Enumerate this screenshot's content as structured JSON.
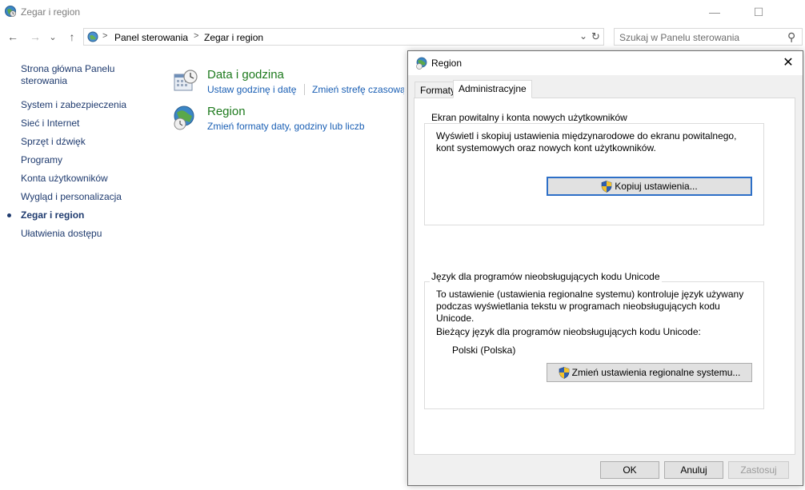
{
  "window": {
    "title": "Zegar i region",
    "controls": {
      "minimize": "—",
      "maximize": "☐"
    }
  },
  "nav": {
    "back": "←",
    "forward": "→",
    "recent": "⌄",
    "up": "↑"
  },
  "address": {
    "crumbs": [
      "Panel sterowania",
      "Zegar i region"
    ],
    "separator": ">",
    "dropdown": "⌄",
    "refresh": "↻"
  },
  "search": {
    "placeholder": "Szukaj w Panelu sterowania",
    "icon": "⚲"
  },
  "sidebar": {
    "items": [
      {
        "label": "Strona główna Panelu",
        "label2": "sterowania"
      },
      {
        "label": "System i zabezpieczenia"
      },
      {
        "label": "Sieć i Internet"
      },
      {
        "label": "Sprzęt i dźwięk"
      },
      {
        "label": "Programy"
      },
      {
        "label": "Konta użytkowników"
      },
      {
        "label": "Wygląd i personalizacja"
      },
      {
        "label": "Zegar i region",
        "active": true
      },
      {
        "label": "Ułatwienia dostępu"
      }
    ]
  },
  "categories": [
    {
      "title": "Data i godzina",
      "links": [
        "Ustaw godzinę i datę",
        "Zmień strefę czasową"
      ]
    },
    {
      "title": "Region",
      "links": [
        "Zmień formaty daty, godziny lub liczb"
      ]
    }
  ],
  "dialog": {
    "title": "Region",
    "close": "✕",
    "tabs": [
      {
        "label": "Formaty",
        "selected": false
      },
      {
        "label": "Administracyjne",
        "selected": true
      }
    ],
    "group1": {
      "legend": "Ekran powitalny i konta nowych użytkowników",
      "line1": "Wyświetl i skopiuj ustawienia międzynarodowe do ekranu powitalnego,",
      "line2": "kont systemowych oraz nowych kont użytkowników.",
      "button": "Kopiuj ustawienia..."
    },
    "group2": {
      "legend": "Język dla programów nieobsługujących kodu Unicode",
      "line1": "To ustawienie (ustawienia regionalne systemu) kontroluje język używany",
      "line2": "podczas wyświetlania tekstu w programach nieobsługujących kodu",
      "line3": "Unicode.",
      "line4": "Bieżący język dla programów nieobsługujących kodu Unicode:",
      "current_language": "Polski (Polska)",
      "button": "Zmień ustawienia regionalne systemu..."
    },
    "buttons": {
      "ok": "OK",
      "cancel": "Anuluj",
      "apply": "Zastosuj"
    }
  },
  "colors": {
    "link": "#1a5fb4",
    "nav_text": "#1e3a6e",
    "category_title": "#1e7a1e",
    "focus_border": "#2d6fc7"
  }
}
